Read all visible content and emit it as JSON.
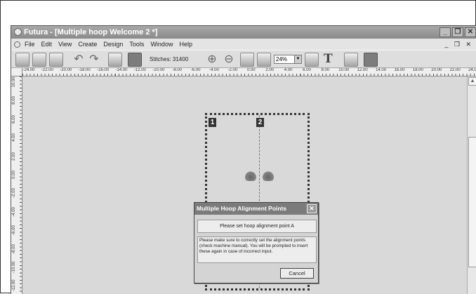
{
  "window": {
    "title": "Futura - [Multiple hoop Welcome 2 *]",
    "buttons": [
      "_",
      "❒",
      "✕"
    ]
  },
  "menubar": {
    "items": [
      "File",
      "Edit",
      "View",
      "Create",
      "Design",
      "Tools",
      "Window",
      "Help"
    ],
    "mdi_controls": "_ ❒ ✕"
  },
  "toolbar": {
    "stitches_label": "Stitches: 31400",
    "zoom_value": "24%",
    "icons": [
      "new-icon",
      "open-icon",
      "save-icon",
      "undo-icon",
      "redo-icon",
      "wand-icon",
      "color-swatch-icon",
      "zoom-in-icon",
      "zoom-out-icon",
      "zoom-fit-icon",
      "zoom-1to1-icon",
      "monitor-icon",
      "text-icon",
      "select-icon",
      "sewing-machine-icon"
    ]
  },
  "rulers": {
    "horizontal": [
      "-24.00",
      "-22.00",
      "-20.00",
      "-18.00",
      "-16.00",
      "-14.00",
      "-12.00",
      "-10.00",
      "-8.00",
      "-6.00",
      "-4.00",
      "-2.00",
      "0.00",
      "2.00",
      "4.00",
      "6.00",
      "8.00",
      "10.00",
      "12.00",
      "14.00",
      "16.00",
      "18.00",
      "20.00",
      "22.00",
      "24.00"
    ],
    "vertical": [
      "10.00",
      "8.00",
      "6.00",
      "4.00",
      "2.00",
      "0.00",
      "-2.00",
      "-4.00",
      "-6.00",
      "-8.00",
      "-10.00",
      "-12.00"
    ]
  },
  "canvas": {
    "hoop_labels": [
      "1",
      "2"
    ]
  },
  "dialog": {
    "title": "Multiple Hoop Alignment Points",
    "prompt": "Please set hoop alignment point A",
    "info": "Please make sure to correctly set the alignment points (check machine manual). You will be prompted to insert these again in case of incorrect input.",
    "cancel_label": "Cancel"
  }
}
